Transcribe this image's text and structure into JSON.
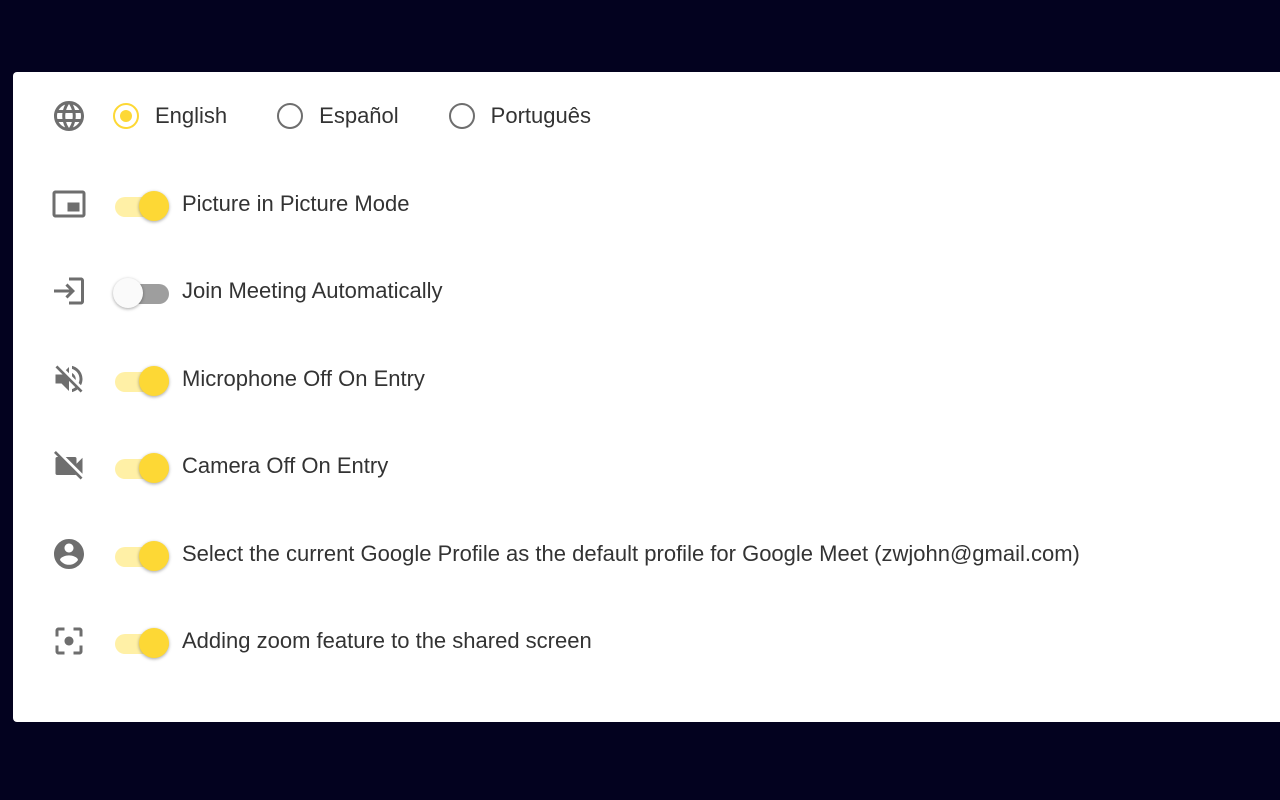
{
  "colors": {
    "background": "#03021f",
    "panel": "#ffffff",
    "accent": "#fdd835",
    "accent_track": "#fff0a6",
    "off_track": "#9e9e9e",
    "icon": "#6e6e6e",
    "text": "#333333"
  },
  "language": {
    "icon": "globe-icon",
    "options": [
      {
        "label": "English",
        "selected": true
      },
      {
        "label": "Español",
        "selected": false
      },
      {
        "label": "Português",
        "selected": false
      }
    ]
  },
  "settings": [
    {
      "icon": "picture-in-picture-icon",
      "label": "Picture in Picture Mode",
      "enabled": true
    },
    {
      "icon": "login-icon",
      "label": "Join Meeting Automatically",
      "enabled": false
    },
    {
      "icon": "volume-off-icon",
      "label": "Microphone Off On Entry",
      "enabled": true
    },
    {
      "icon": "videocam-off-icon",
      "label": "Camera Off On Entry",
      "enabled": true
    },
    {
      "icon": "account-circle-icon",
      "label": "Select the current Google Profile as the default profile for Google Meet (zwjohn@gmail.com)",
      "enabled": true
    },
    {
      "icon": "center-focus-icon",
      "label": "Adding zoom feature to the shared screen",
      "enabled": true
    }
  ]
}
